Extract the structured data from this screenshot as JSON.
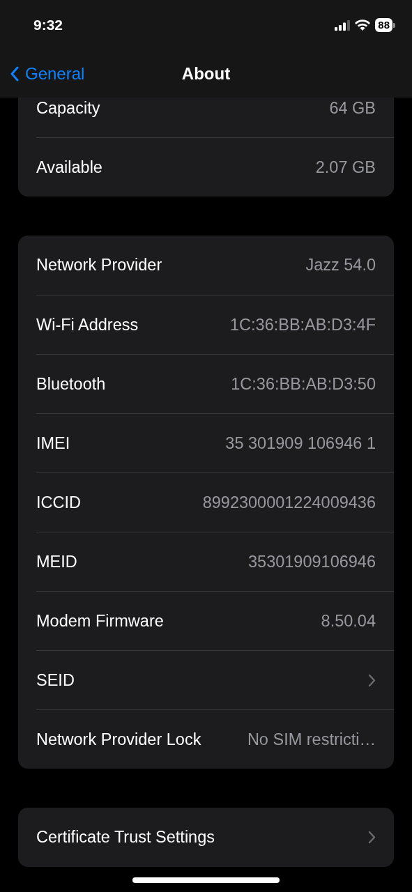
{
  "status_bar": {
    "time": "9:32",
    "battery": "88"
  },
  "nav": {
    "back_label": "General",
    "title": "About"
  },
  "groups": [
    {
      "clipped_top": true,
      "rows": [
        {
          "kind": "value",
          "label": "Capacity",
          "value": "64 GB"
        },
        {
          "kind": "value",
          "label": "Available",
          "value": "2.07 GB"
        }
      ]
    },
    {
      "clipped_top": false,
      "rows": [
        {
          "kind": "value",
          "label": "Network Provider",
          "value": "Jazz 54.0"
        },
        {
          "kind": "value",
          "label": "Wi-Fi Address",
          "value": "1C:36:BB:AB:D3:4F"
        },
        {
          "kind": "value",
          "label": "Bluetooth",
          "value": "1C:36:BB:AB:D3:50"
        },
        {
          "kind": "value",
          "label": "IMEI",
          "value": "35 301909 106946 1"
        },
        {
          "kind": "value",
          "label": "ICCID",
          "value": "8992300001224009436"
        },
        {
          "kind": "value",
          "label": "MEID",
          "value": "35301909106946"
        },
        {
          "kind": "value",
          "label": "Modem Firmware",
          "value": "8.50.04"
        },
        {
          "kind": "disclosure",
          "label": "SEID"
        },
        {
          "kind": "value",
          "label": "Network Provider Lock",
          "value": "No SIM restricti…"
        }
      ]
    },
    {
      "clipped_top": false,
      "rows": [
        {
          "kind": "disclosure",
          "label": "Certificate Trust Settings"
        }
      ]
    }
  ]
}
